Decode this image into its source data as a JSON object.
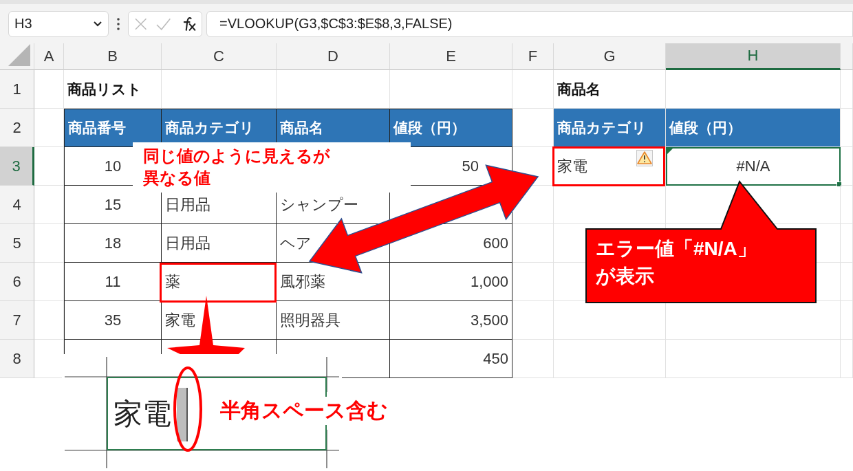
{
  "name_box": {
    "value": "H3"
  },
  "formula_bar": {
    "formula": "=VLOOKUP(G3,$C$3:$E$8,3,FALSE)"
  },
  "sheet": {
    "columns": [
      {
        "label": "A",
        "selected": false
      },
      {
        "label": "B",
        "selected": false
      },
      {
        "label": "C",
        "selected": false
      },
      {
        "label": "D",
        "selected": false
      },
      {
        "label": "E",
        "selected": false
      },
      {
        "label": "F",
        "selected": false
      },
      {
        "label": "G",
        "selected": false
      },
      {
        "label": "H",
        "selected": true
      }
    ],
    "rows": [
      {
        "label": "1",
        "selected": false
      },
      {
        "label": "2",
        "selected": false
      },
      {
        "label": "3",
        "selected": true
      },
      {
        "label": "4",
        "selected": false
      },
      {
        "label": "5",
        "selected": false
      },
      {
        "label": "6",
        "selected": false
      },
      {
        "label": "7",
        "selected": false
      },
      {
        "label": "8",
        "selected": false
      }
    ]
  },
  "product_list": {
    "title": "商品リスト",
    "headers": [
      "商品番号",
      "商品カテゴリ",
      "商品名",
      "値段（円）"
    ],
    "items": [
      {
        "number": "10",
        "price": "50"
      },
      {
        "number": "15",
        "category": "日用品",
        "name": "シャンプー"
      },
      {
        "number": "18",
        "category": "日用品",
        "name": "ヘア",
        "price": "600"
      },
      {
        "number": "11",
        "category": "薬",
        "name": "風邪薬",
        "price": "1,000"
      },
      {
        "number": "35",
        "category": "家電",
        "name": "照明器具",
        "price": "3,500"
      },
      {
        "price": "450"
      }
    ]
  },
  "lookup": {
    "title": "商品名",
    "headers": [
      "商品カテゴリ",
      "値段（円）"
    ],
    "category": "家電",
    "result": "#N/A"
  },
  "annotations": {
    "note": {
      "lines": [
        "同じ値のように見えるが",
        "異なる値"
      ]
    },
    "error_callout": {
      "lines": [
        "エラー値「#N/A」",
        "が表示"
      ]
    },
    "inset": {
      "cell_text": "家電",
      "label": "半角スペース含む"
    }
  }
}
